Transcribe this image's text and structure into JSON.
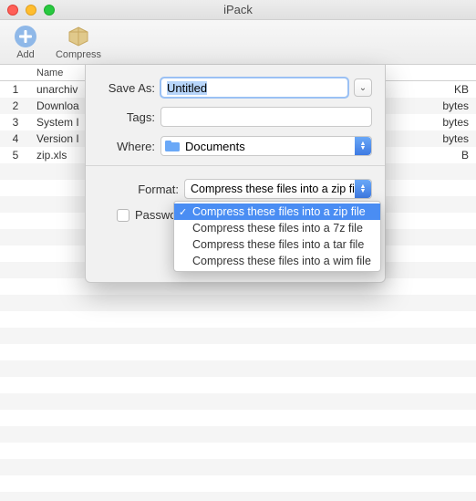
{
  "window": {
    "title": "iPack"
  },
  "toolbar": {
    "add_label": "Add",
    "compress_label": "Compress"
  },
  "table": {
    "headers": {
      "num": "",
      "name": "Name",
      "size": ""
    },
    "rows": [
      {
        "num": "1",
        "name": "unarchiv",
        "size": "KB"
      },
      {
        "num": "2",
        "name": "Downloa",
        "size": "bytes"
      },
      {
        "num": "3",
        "name": "System I",
        "size": "bytes"
      },
      {
        "num": "4",
        "name": "Version I",
        "size": "bytes"
      },
      {
        "num": "5",
        "name": "zip.xls",
        "size": "B"
      }
    ]
  },
  "sheet": {
    "save_as_label": "Save As:",
    "save_as_value": "Untitled",
    "tags_label": "Tags:",
    "tags_value": "",
    "where_label": "Where:",
    "where_value": "Documents",
    "format_label": "Format:",
    "format_value": "Compress these files into a zip file",
    "password_label": "Password:"
  },
  "format_menu": {
    "items": [
      "Compress these files into a zip file",
      "Compress these files into a 7z file",
      "Compress these files into a tar file",
      "Compress these files into a wim file"
    ],
    "selected_index": 0
  }
}
